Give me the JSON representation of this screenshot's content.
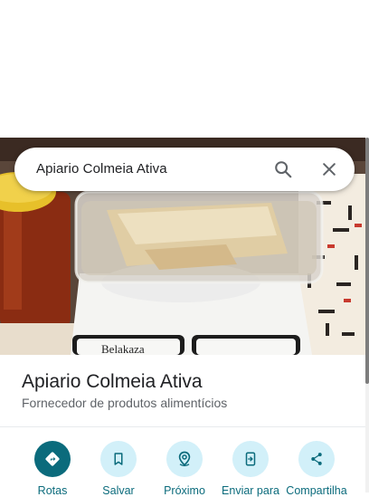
{
  "search": {
    "query": "Apiario Colmeia Ativa"
  },
  "place": {
    "title": "Apiario Colmeia Ativa",
    "category": "Fornecedor de produtos alimentícios",
    "photo_label": "Belakaza"
  },
  "actions": [
    {
      "label": "Rotas",
      "icon": "directions-icon"
    },
    {
      "label": "Salvar",
      "icon": "bookmark-icon"
    },
    {
      "label": "Próximo",
      "icon": "nearby-icon"
    },
    {
      "label": "Enviar para",
      "icon": "send-to-phone-icon"
    },
    {
      "label": "Compartilha",
      "icon": "share-icon"
    }
  ],
  "colors": {
    "accent": "#0b6b7c",
    "action_bg": "#d2f0f9",
    "title_text": "#202124",
    "secondary_text": "#5f6368"
  }
}
